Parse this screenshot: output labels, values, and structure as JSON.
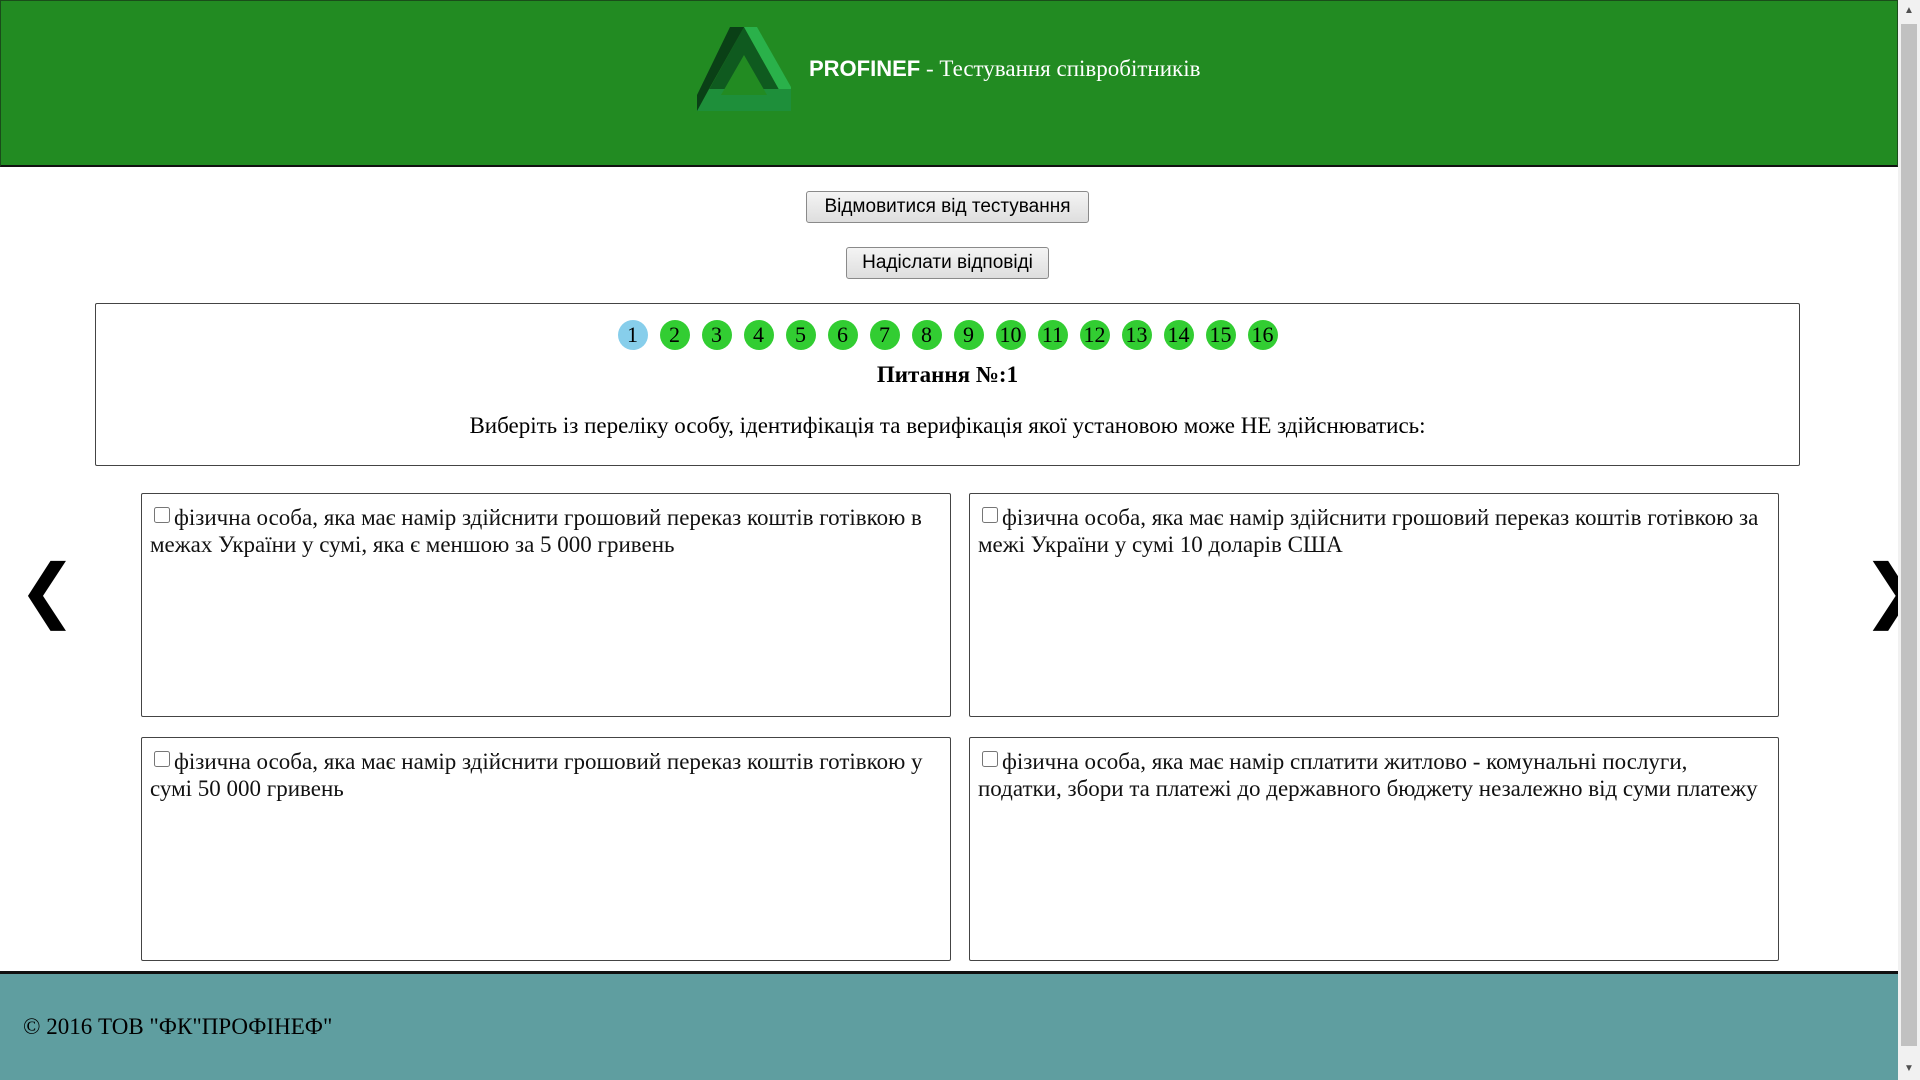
{
  "header": {
    "brand_name": "PROFINEF",
    "brand_subtitle": " - Тестування співробітників",
    "logo_icon": "triangle-logo-icon",
    "background_color": "#228b22"
  },
  "actions": {
    "refuse_label": "Відмовитися від тестування",
    "submit_label": "Надіслати відповіді"
  },
  "question_nav": {
    "items": [
      "1",
      "2",
      "3",
      "4",
      "5",
      "6",
      "7",
      "8",
      "9",
      "10",
      "11",
      "12",
      "13",
      "14",
      "15",
      "16"
    ],
    "active": "1",
    "active_color": "#87ceeb",
    "inactive_color": "#32cd32"
  },
  "question": {
    "title": "Питання №:1",
    "text": "Виберіть із переліку особу, ідентифікація та верифікація якої установою може НЕ здійснюватись:"
  },
  "answers": [
    {
      "text": "фізична особа, яка має намір здійснити грошовий переказ коштів готівкою в межах України у сумі, яка є меншою за 5 000 гривень",
      "checked": false
    },
    {
      "text": "фізична особа, яка має намір здійснити грошовий переказ коштів готівкою за межі України у сумі 10 доларів США",
      "checked": false
    },
    {
      "text": "фізична особа, яка має намір здійснити грошовий переказ коштів готівкою у сумі 50 000 гривень",
      "checked": false
    },
    {
      "text": "фізична особа, яка має намір сплатити житлово - комунальні послуги, податки, збори та платежі до державного бюджету незалежно від суми платежу",
      "checked": false
    }
  ],
  "navigation": {
    "prev": "❮",
    "next": "❯",
    "prev_icon": "chevron-left-icon",
    "next_icon": "chevron-right-icon"
  },
  "footer": {
    "copyright": "© 2016 ТОВ \"ФК\"ПРОФІНЕФ\"",
    "background_color": "#5f9ea0"
  }
}
